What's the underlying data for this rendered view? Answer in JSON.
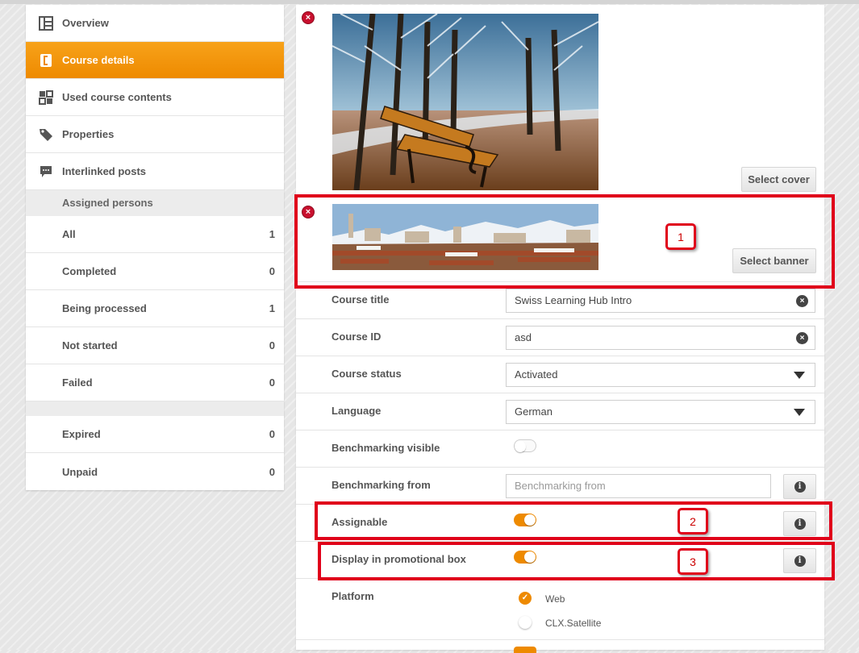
{
  "sidebar": {
    "nav": [
      {
        "label": "Overview",
        "icon": "grid-icon",
        "active": false
      },
      {
        "label": "Course details",
        "icon": "document-icon",
        "active": true
      },
      {
        "label": "Used course contents",
        "icon": "puzzle-icon",
        "active": false
      },
      {
        "label": "Properties",
        "icon": "tag-icon",
        "active": false
      },
      {
        "label": "Interlinked posts",
        "icon": "chat-icon",
        "active": false
      }
    ],
    "assigned_header": "Assigned persons",
    "counts": [
      {
        "label": "All",
        "value": "1"
      },
      {
        "label": "Completed",
        "value": "0"
      },
      {
        "label": "Being processed",
        "value": "1"
      },
      {
        "label": "Not started",
        "value": "0"
      },
      {
        "label": "Failed",
        "value": "0"
      }
    ],
    "counts2": [
      {
        "label": "Expired",
        "value": "0"
      },
      {
        "label": "Unpaid",
        "value": "0"
      }
    ]
  },
  "media": {
    "select_cover": "Select cover",
    "select_banner": "Select banner",
    "remove_glyph": "×"
  },
  "form": {
    "course_title": {
      "label": "Course title",
      "value": "Swiss Learning Hub Intro"
    },
    "course_id": {
      "label": "Course ID",
      "value": "asd"
    },
    "course_status": {
      "label": "Course status",
      "value": "Activated"
    },
    "language": {
      "label": "Language",
      "value": "German"
    },
    "benchmarking_visible": {
      "label": "Benchmarking visible",
      "on": false
    },
    "benchmarking_from": {
      "label": "Benchmarking from",
      "placeholder": "Benchmarking from"
    },
    "assignable": {
      "label": "Assignable",
      "on": true
    },
    "promo_box": {
      "label": "Display in promotional box",
      "on": true
    },
    "platform": {
      "label": "Platform",
      "options": [
        {
          "label": "Web",
          "checked": true
        },
        {
          "label": "CLX.Satellite",
          "checked": false
        }
      ]
    },
    "clear_glyph": "×",
    "info_glyph": "i"
  },
  "annotations": {
    "callout_1": "1",
    "callout_2": "2",
    "callout_3": "3",
    "color": "#e0001a"
  },
  "colors": {
    "accent": "#ee8a00",
    "remove": "#c8102e"
  }
}
